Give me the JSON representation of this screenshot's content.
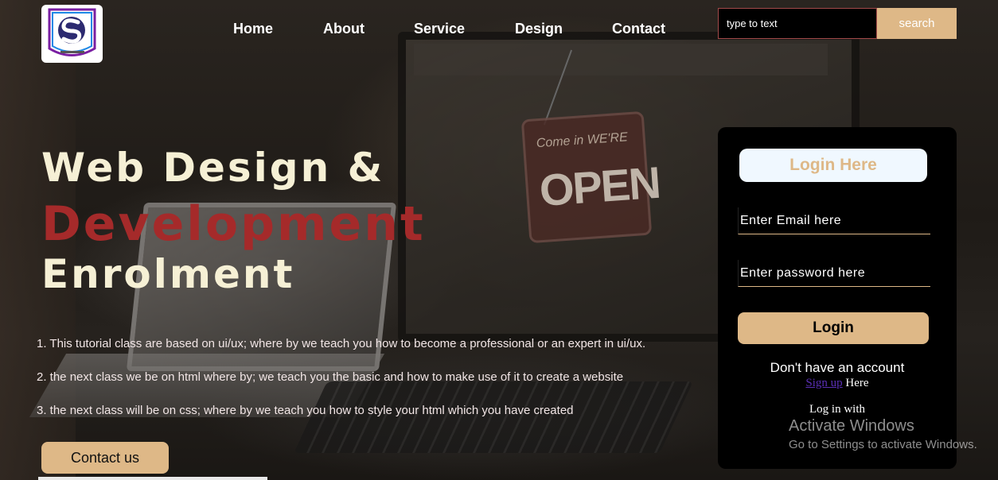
{
  "header": {
    "nav": [
      {
        "label": "Home"
      },
      {
        "label": "About"
      },
      {
        "label": "Service"
      },
      {
        "label": "Design"
      },
      {
        "label": "Contact"
      }
    ],
    "search": {
      "placeholder": "type to text",
      "button_label": "search"
    }
  },
  "hero": {
    "line1": "Web Design &",
    "line2": "Development",
    "line3": "Enrolment",
    "paragraphs": [
      "1. This tutorial class are based on ui/ux; where by we teach you how to become a professional or an expert in ui/ux.",
      "2. the next class we be on html where by; we teach you the basic and how to make use of it to create a website",
      "3. the next class will be on css; where by we teach you how to style your html which you have created"
    ],
    "contact_button": "Contact us"
  },
  "background": {
    "sign_line1": "Come in WE'RE",
    "sign_line2": "OPEN"
  },
  "login": {
    "title": "Login Here",
    "email_placeholder": "Enter Email here",
    "password_placeholder": "Enter password here",
    "button_label": "Login",
    "no_account": "Don't have an account",
    "signup_link": "Sign up",
    "signup_suffix": " Here",
    "log_in_with": "Log in with"
  },
  "watermark": {
    "title": "Activate Windows",
    "subtitle": "Go to Settings to activate Windows."
  },
  "colors": {
    "accent": "#deb887",
    "hero_red": "#a52a2a",
    "hero_cream": "#f6f0d5",
    "panel": "#000000"
  }
}
